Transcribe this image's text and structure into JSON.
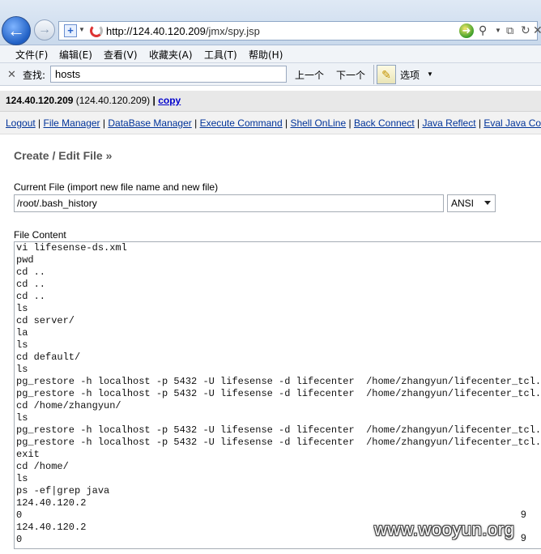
{
  "browser": {
    "url_scheme_host": "http://124.40.120.209",
    "url_path": "/jmx/spy.jsp"
  },
  "menu": [
    "文件(F)",
    "编辑(E)",
    "查看(V)",
    "收藏夹(A)",
    "工具(T)",
    "帮助(H)"
  ],
  "findbar": {
    "close": "✕",
    "label": "查找:",
    "query": "hosts",
    "prev": "上一个",
    "next": "下一个",
    "options": "选项"
  },
  "host": {
    "name": "124.40.120.209",
    "paren": "(124.40.120.209)",
    "sep": "|",
    "copy": "copy"
  },
  "nav": {
    "items": [
      "Logout",
      "File Manager",
      "DataBase Manager",
      "Execute Command",
      "Shell OnLine",
      "Back Connect",
      "Java Reflect",
      "Eval Java Co"
    ],
    "sep": "|"
  },
  "section_title": "Create / Edit File »",
  "current_file": {
    "label": "Current File (import new file name and new file)",
    "value": "/root/.bash_history",
    "encoding": "ANSI"
  },
  "file_content": {
    "label": "File Content",
    "lines": [
      "vi lifesense-ds.xml",
      "pwd",
      "cd ..",
      "cd ..",
      "cd ..",
      "ls",
      "cd server/",
      "la",
      "ls",
      "cd default/",
      "ls",
      "pg_restore -h localhost -p 5432 -U lifesense -d lifecenter  /home/zhangyun/lifecenter_tcl.bac",
      "pg_restore -h localhost -p 5432 -U lifesense -d lifecenter  /home/zhangyun/lifecenter_tcl.bac",
      "cd /home/zhangyun/",
      "ls",
      "pg_restore -h localhost -p 5432 -U lifesense -d lifecenter  /home/zhangyun/lifecenter_tcl.bac",
      "pg_restore -h localhost -p 5432 -U lifesense -d lifecenter  /home/zhangyun/lifecenter_tcl.bac",
      "exit",
      "cd /home/",
      "ls",
      "ps -ef|grep java",
      "124.40.120.2",
      "0",
      "124.40.120.2",
      "0"
    ],
    "side_numbers": [
      "9",
      "9"
    ]
  },
  "watermark": "www.wooyun.org"
}
